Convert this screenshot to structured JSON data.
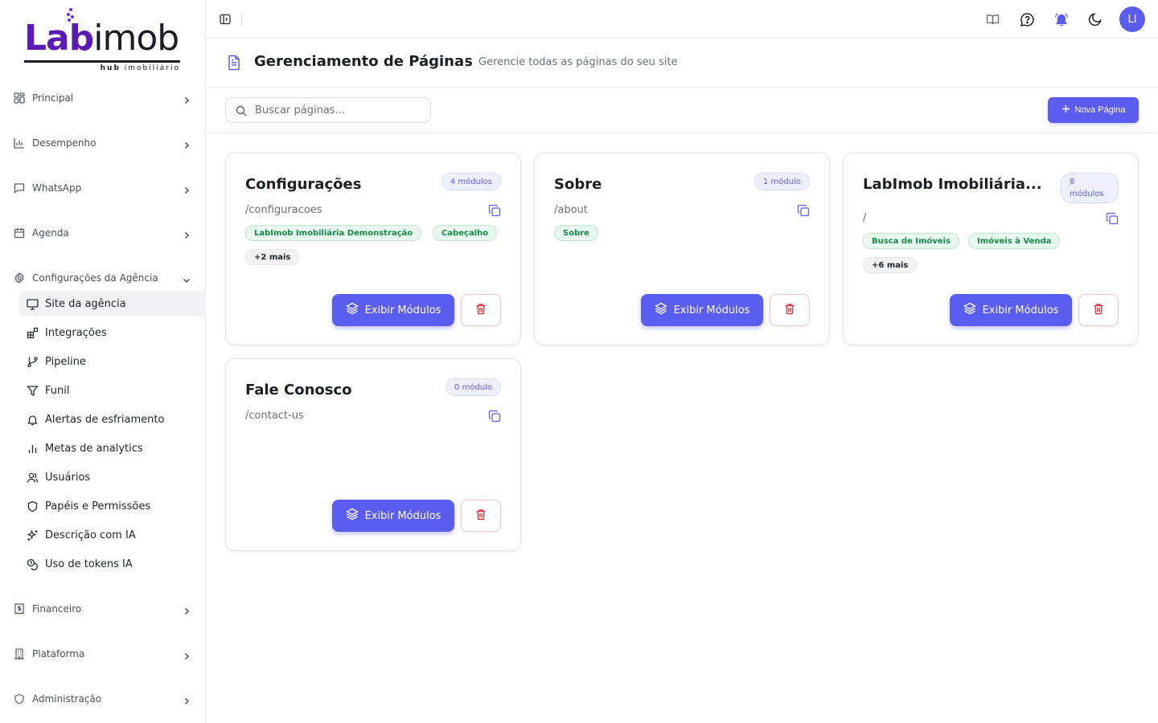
{
  "brand": {
    "name_part1": "Lab",
    "name_part2": "imob",
    "subtitle_bold": "hub",
    "subtitle_rest": "imobiliário",
    "accent": "#5b1bb5"
  },
  "sidebar": {
    "groups": [
      {
        "label": "Principal",
        "icon": "layout-grid-icon"
      },
      {
        "label": "Desempenho",
        "icon": "bar-chart-icon"
      },
      {
        "label": "WhatsApp",
        "icon": "message-square-icon"
      },
      {
        "label": "Agenda",
        "icon": "calendar-icon"
      },
      {
        "label": "Configurações da Agência",
        "icon": "gear-icon"
      },
      {
        "label": "Financeiro",
        "icon": "receipt-icon"
      },
      {
        "label": "Plataforma",
        "icon": "building-icon"
      },
      {
        "label": "Administração",
        "icon": "shield-icon"
      }
    ],
    "sub_items": [
      {
        "label": "Site da agência",
        "icon": "monitor-icon",
        "active": true
      },
      {
        "label": "Integrações",
        "icon": "blocks-icon"
      },
      {
        "label": "Pipeline",
        "icon": "git-branch-icon"
      },
      {
        "label": "Funil",
        "icon": "funnel-icon"
      },
      {
        "label": "Alertas de esfriamento",
        "icon": "bell-icon"
      },
      {
        "label": "Metas de analytics",
        "icon": "chart-icon"
      },
      {
        "label": "Usuários",
        "icon": "users-icon"
      },
      {
        "label": "Papéis e Permissões",
        "icon": "shield-icon"
      },
      {
        "label": "Descrição com IA",
        "icon": "sparkles-icon"
      },
      {
        "label": "Uso de tokens IA",
        "icon": "coins-icon"
      }
    ]
  },
  "topbar": {
    "avatar_initials": "LI",
    "accent": "#5b5cf0"
  },
  "page": {
    "title": "Gerenciamento de Páginas",
    "subtitle": "Gerencie todas as páginas do seu site",
    "search_placeholder": "Buscar páginas...",
    "new_button": "Nova Página"
  },
  "cards": [
    {
      "title": "Configurações",
      "modules": "4 módulos",
      "path": "/configuracoes",
      "tags": [
        "LabImob Imobiliária Demonstração",
        "Cabeçalho"
      ],
      "more": "+2 mais",
      "show_label": "Exibir Módulos"
    },
    {
      "title": "Sobre",
      "modules": "1 módulo",
      "path": "/about",
      "tags": [
        "Sobre"
      ],
      "more": "",
      "show_label": "Exibir Módulos"
    },
    {
      "title": "LabImob Imobiliária...",
      "modules_line1": "8",
      "modules_line2": "módulos",
      "path": "/",
      "tags": [
        "Busca de Imóveis",
        "Imóveis à Venda"
      ],
      "more": "+6 mais",
      "show_label": "Exibir Módulos"
    },
    {
      "title": "Fale Conosco",
      "modules": "0 módulo",
      "path": "/contact-us",
      "tags": [],
      "more": "",
      "show_label": "Exibir Módulos"
    }
  ]
}
